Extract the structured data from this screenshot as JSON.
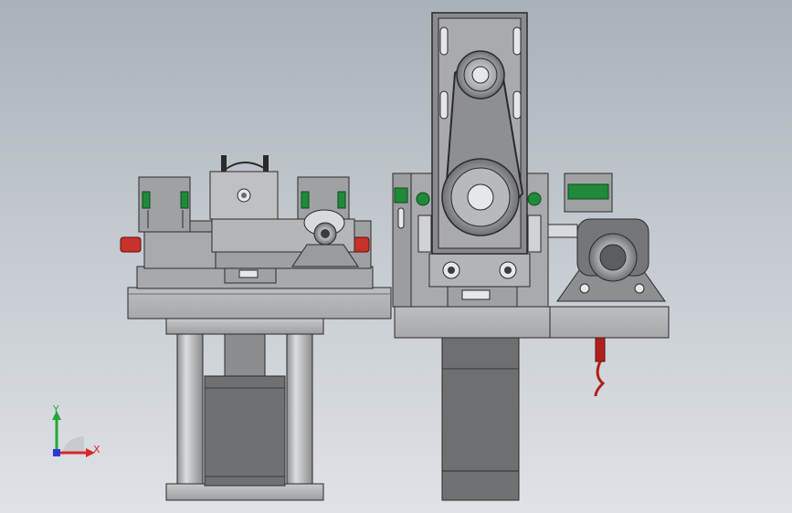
{
  "view": {
    "background": {
      "top": "#a9b1b9",
      "bottom": "#dfe2e6"
    },
    "part_colors": {
      "metal": "#a2a3a6",
      "metal_light": "#c3c4c6",
      "motor_dark": "#6e6f72",
      "green_pad": "#1f8a3a",
      "red_cap": "#c8322a",
      "cable": "#b0201a"
    }
  },
  "triad": {
    "y_label": "Y",
    "x_label": "X",
    "y_color": "#22a83a",
    "x_color": "#d8282a",
    "z_color": "#2a3ad8"
  }
}
